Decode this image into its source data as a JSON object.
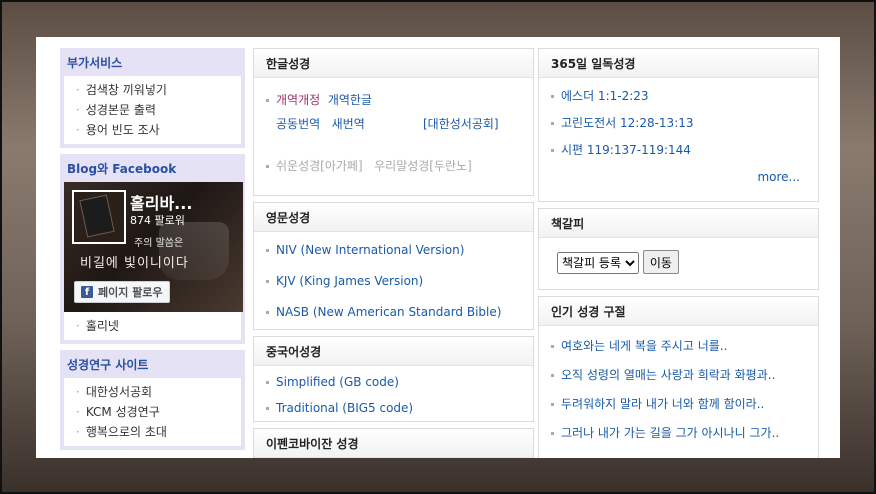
{
  "sidebar": {
    "services": {
      "title": "부가서비스",
      "items": [
        "검색창 끼워넣기",
        "성경본문 출력",
        "용어 빈도 조사"
      ]
    },
    "blog": {
      "title": "Blog와 Facebook",
      "page_name": "홀리바...",
      "followers": "874 팔로워",
      "overlay_text": "비길에 빛이니이다",
      "overlay_small": "주의 말씀은",
      "follow_button": "페이지 팔로우",
      "fb_letter": "f",
      "link": "홀리넷"
    },
    "research": {
      "title": "성경연구 사이트",
      "items": [
        "대한성서공회",
        "KCM 성경연구",
        "행복으로의 초대"
      ]
    }
  },
  "korean": {
    "title": "한글성경",
    "item1_a": "개역개정",
    "item1_b": "개역한글",
    "item2_a": "공동번역",
    "item2_b": "새번역",
    "item2_c": "[대한성서공회]",
    "item3_a": "쉬운성경[아가페]",
    "item3_b": "우리말성경[두란노]"
  },
  "english": {
    "title": "영문성경",
    "items": [
      "NIV (New International Version)",
      "KJV (King James Version)",
      "NASB (New American Standard Bible)"
    ]
  },
  "chinese": {
    "title": "중국어성경",
    "items": [
      "Simplified (GB code)",
      "Traditional (BIG5 code)"
    ]
  },
  "next_box": {
    "title": "이펜코바이잔 성경"
  },
  "daily": {
    "title": "365일 일독성경",
    "items": [
      "에스더 1:1-2:23",
      "고린도전서 12:28-13:13",
      "시편 119:137-119:144"
    ],
    "more": "more..."
  },
  "bookmark": {
    "title": "책갈피",
    "select_value": "책갈피 등록",
    "go_button": "이동"
  },
  "popular": {
    "title": "인기 성경 구절",
    "items": [
      "여호와는 네게 복을 주시고 너를..",
      "오직 성령의 열매는 사랑과 희락과 화평과..",
      "두려워하지 말라 내가 너와 함께 함이라..",
      "그러나 내가 가는 길을 그가 아시나니 그가.."
    ]
  },
  "colors": {
    "link": "#1a5aa8",
    "sidebar_bg": "#e5e2f5",
    "sidebar_title": "#2b4fa2",
    "accent_red": "#a0306a"
  }
}
